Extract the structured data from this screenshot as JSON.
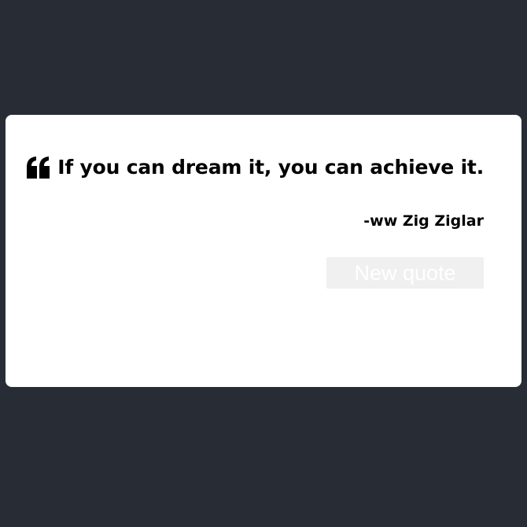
{
  "quote": {
    "text": "If you can dream it, you can achieve it.",
    "author": "-ww Zig Ziglar",
    "icon": "quote-left-icon"
  },
  "actions": {
    "new_quote_label": "New quote"
  },
  "colors": {
    "background": "#282c34",
    "card": "#ffffff",
    "text": "#000000",
    "button_bg": "#f0f0f0",
    "button_text": "#ffffff"
  }
}
